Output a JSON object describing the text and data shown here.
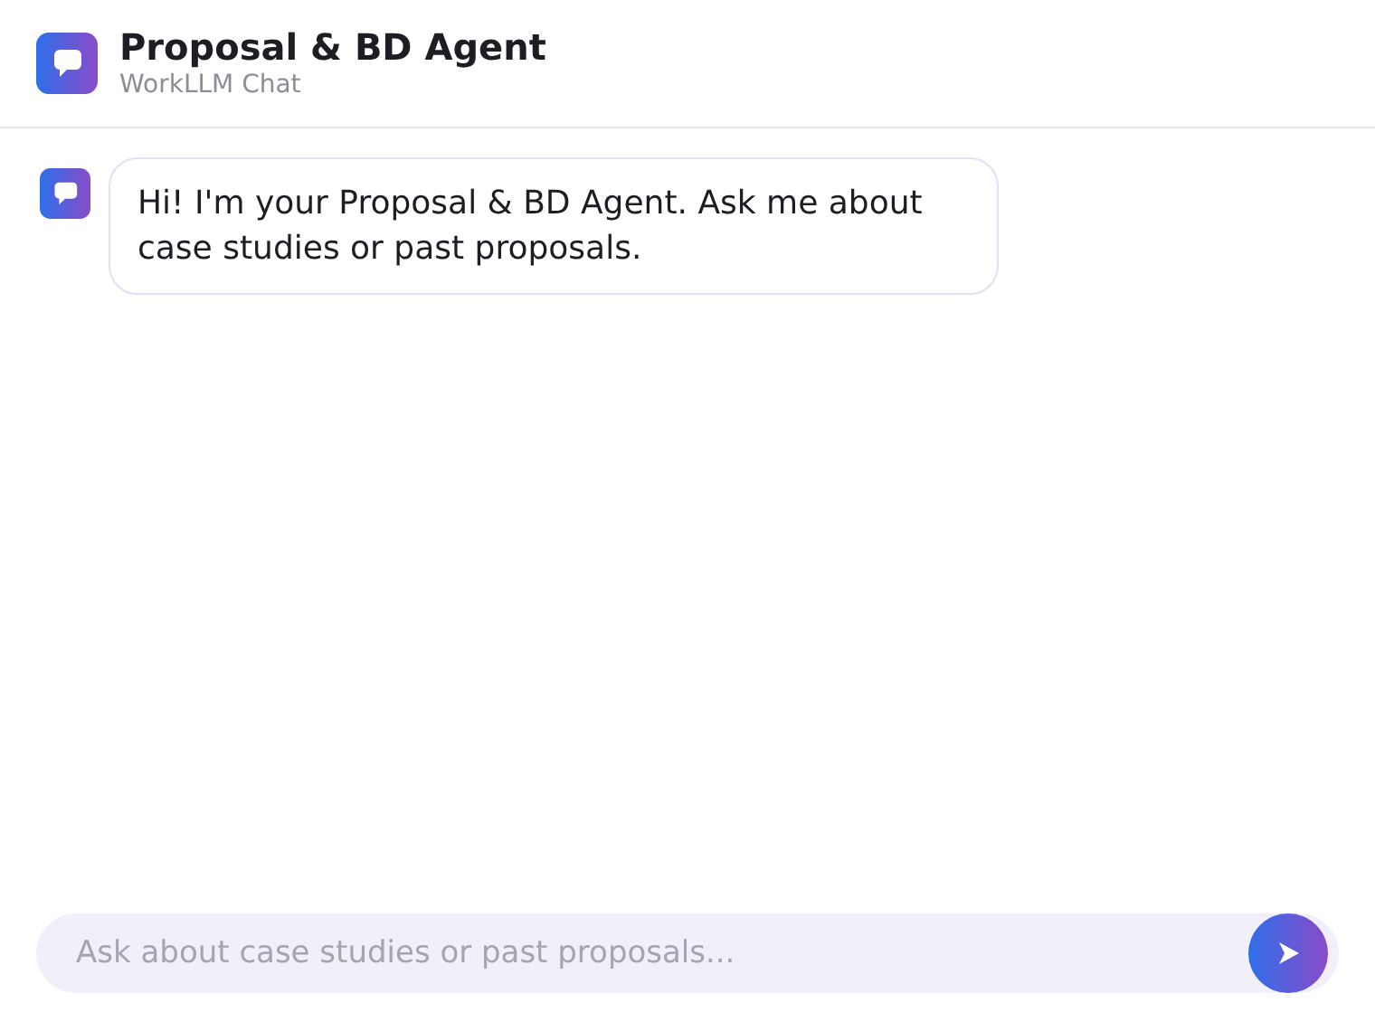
{
  "header": {
    "title": "Proposal & BD Agent",
    "subtitle": "WorkLLM Chat"
  },
  "messages": [
    {
      "kind": "agent",
      "text": "Hi! I'm your Proposal & BD Agent. Ask me about case studies or past proposals."
    }
  ],
  "composer": {
    "placeholder": "Ask about case studies or past proposals..."
  }
}
